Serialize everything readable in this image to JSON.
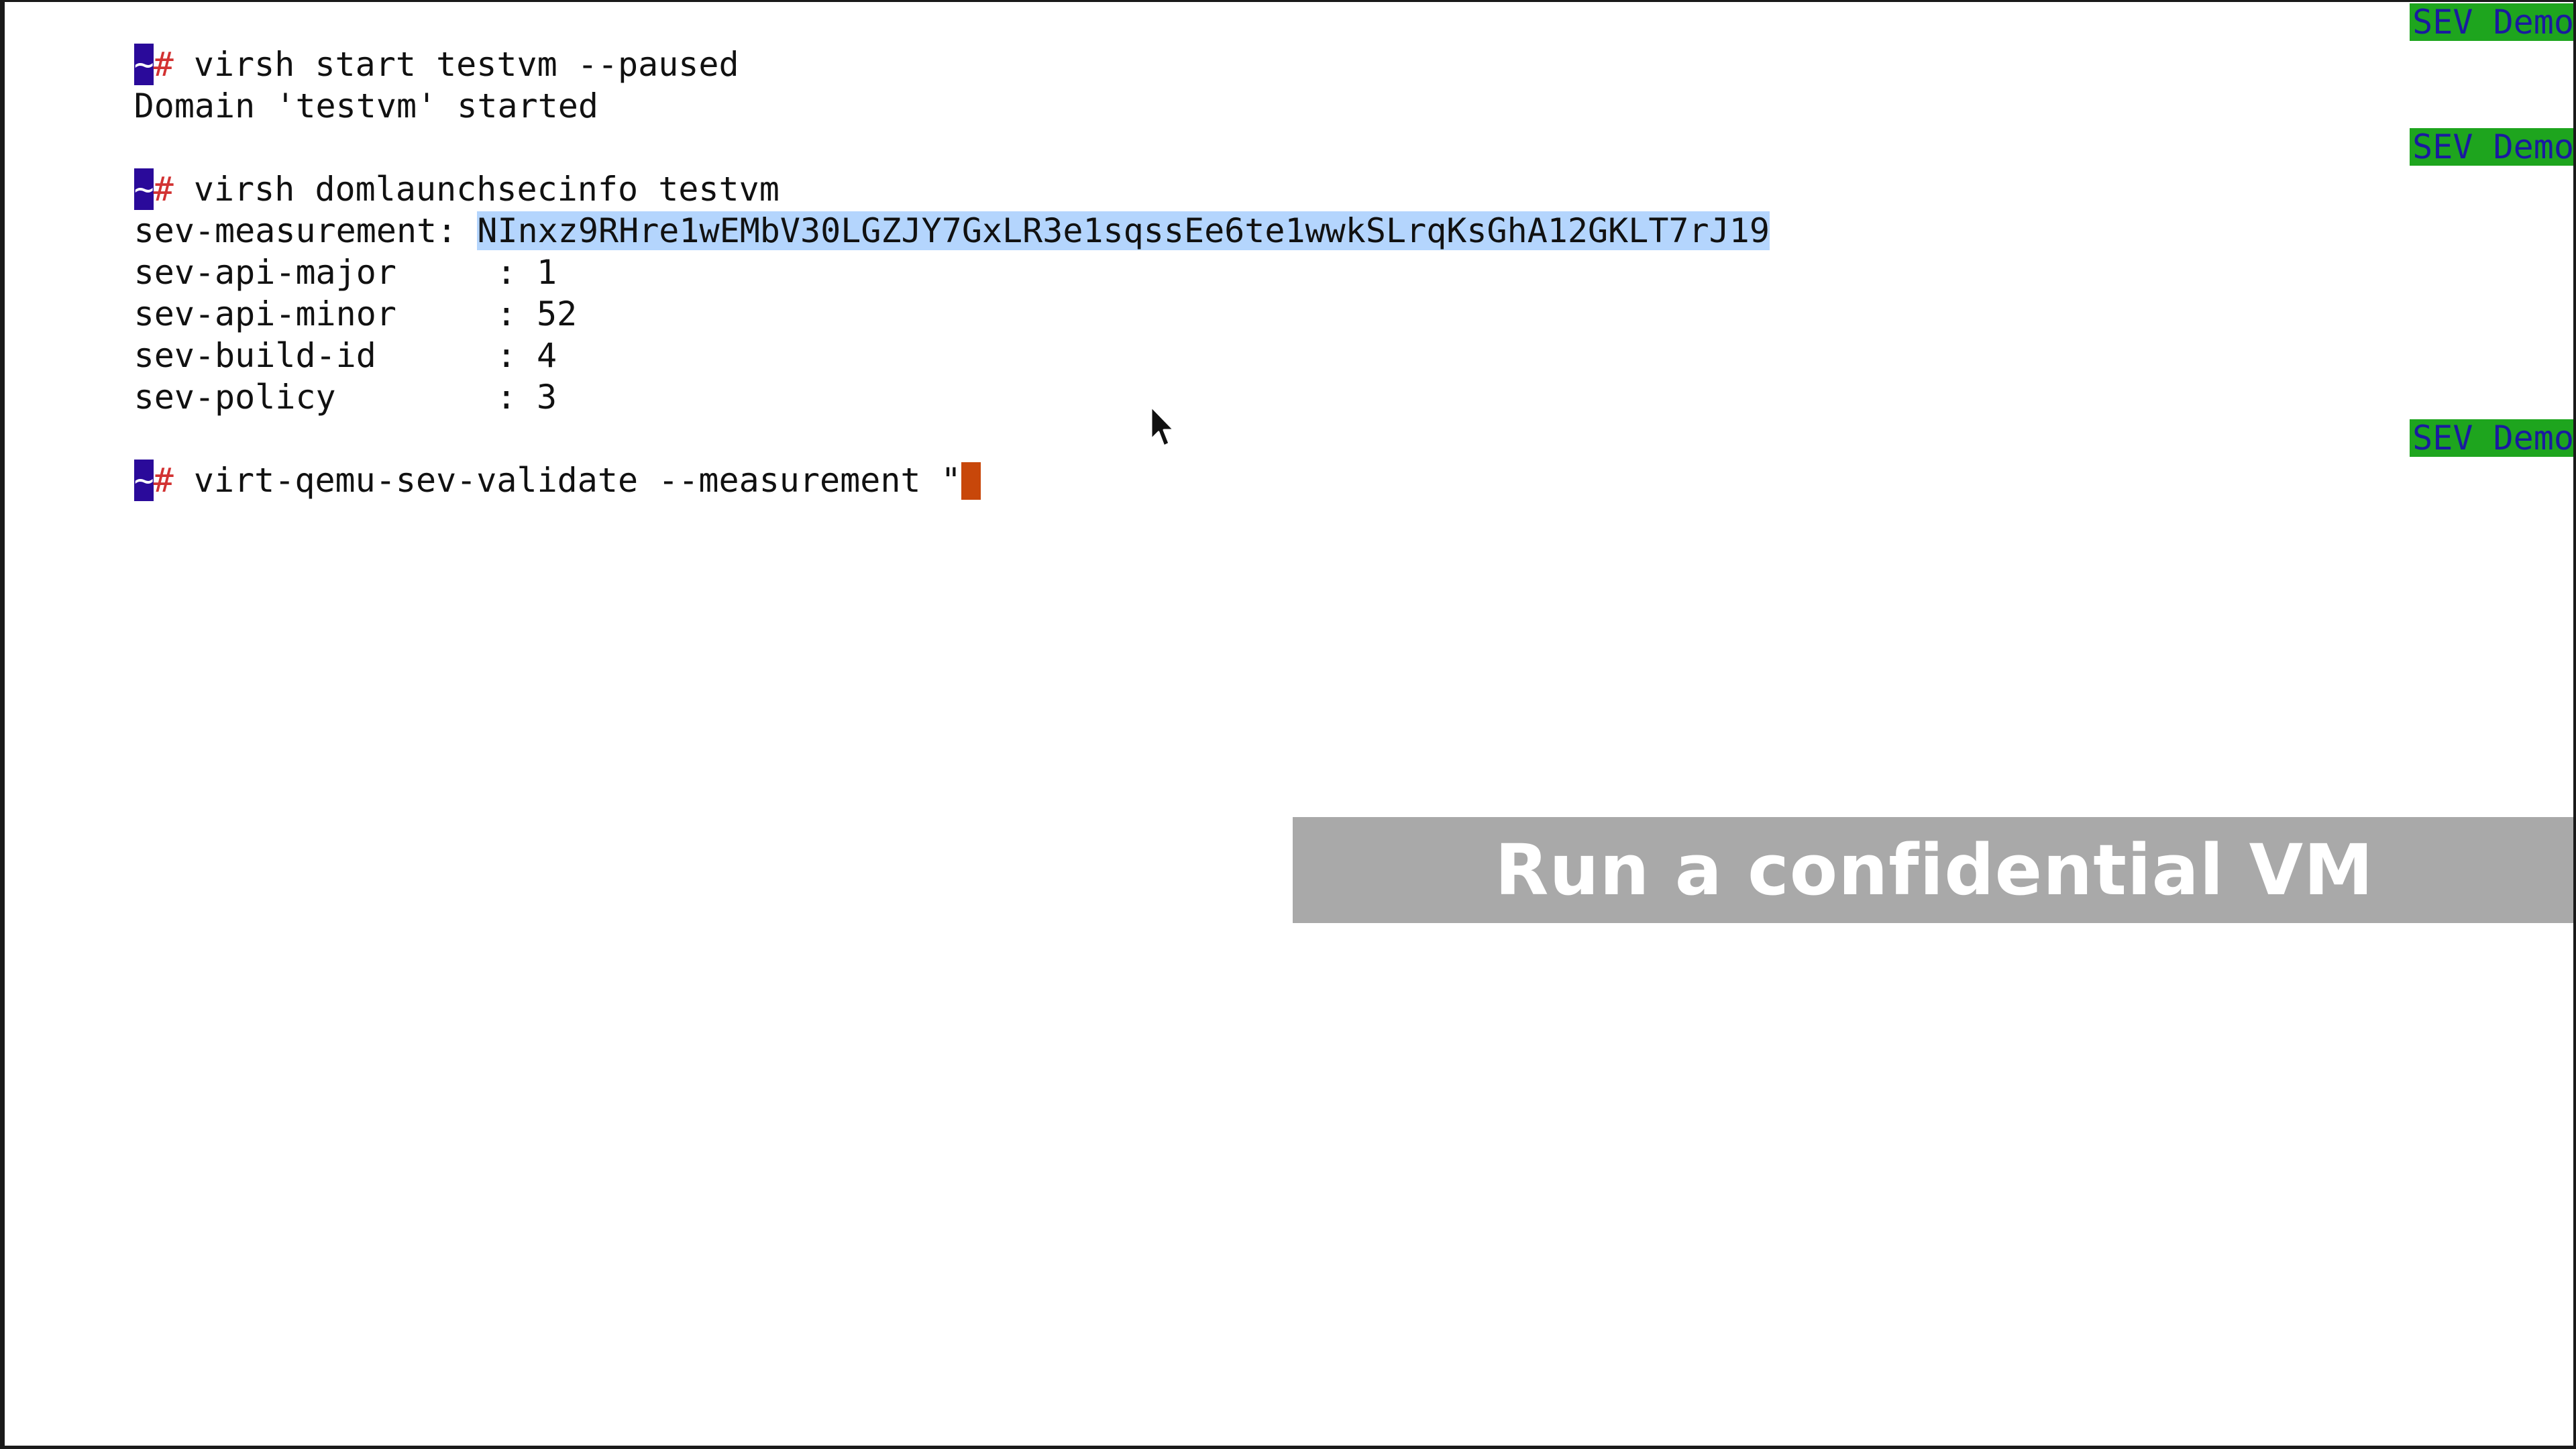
{
  "terminal": {
    "prompt_tilde": "~",
    "prompt_hash": "#",
    "badge_label": "SEV Demo",
    "line1": {
      "command": " virsh start testvm --paused"
    },
    "line2": {
      "output": "Domain 'testvm' started"
    },
    "line3": {
      "command": " virsh domlaunchsecinfo testvm"
    },
    "measurement": {
      "label": "sev-measurement: ",
      "value": "NInxz9RHre1wEMbV30LGZJY7GxLR3e1sqssEe6te1wwkSLrqKsGhA12GKLT7rJ19"
    },
    "fields": [
      {
        "label": "sev-api-major",
        "sep": " : ",
        "value": "1"
      },
      {
        "label": "sev-api-minor",
        "sep": " : ",
        "value": "52"
      },
      {
        "label": "sev-build-id",
        "sep": " : ",
        "value": "4"
      },
      {
        "label": "sev-policy",
        "sep": " : ",
        "value": "3"
      }
    ],
    "line_last": {
      "command": " virt-qemu-sev-validate --measurement \""
    }
  },
  "caption": {
    "text": "Run a confidential VM"
  },
  "colors": {
    "badge_bg": "#1ea51e",
    "badge_text": "#1a1aa0",
    "prompt_bg": "#2a0a9a",
    "prompt_hash": "#d23232",
    "selection": "#b4d5fd",
    "cursor": "#c8470a",
    "caption_bg": "#a9a9a9"
  },
  "icons": {
    "pointer": "mouse-pointer-icon"
  }
}
